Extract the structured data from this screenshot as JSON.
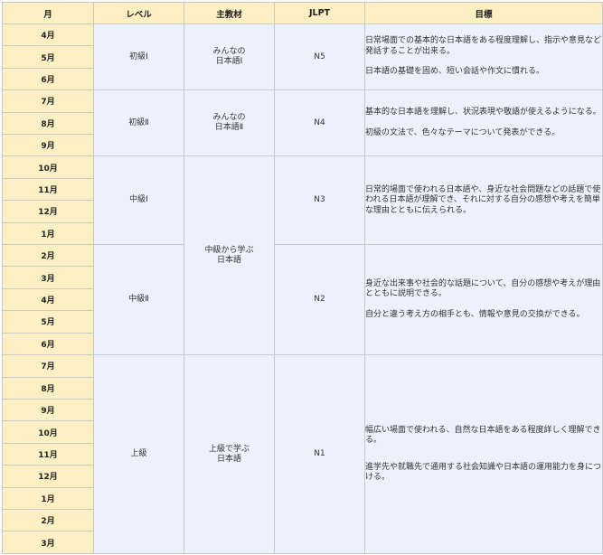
{
  "headers": {
    "month": "月",
    "level": "レベル",
    "textbook": "主教材",
    "jlpt": "JLPT",
    "goal": "目標"
  },
  "months": [
    "4月",
    "5月",
    "6月",
    "7月",
    "8月",
    "9月",
    "10月",
    "11月",
    "12月",
    "1月",
    "2月",
    "3月",
    "4月",
    "5月",
    "6月",
    "7月",
    "8月",
    "9月",
    "10月",
    "11月",
    "12月",
    "1月",
    "2月",
    "3月"
  ],
  "levels": [
    "初級Ⅰ",
    "初級Ⅱ",
    "中級Ⅰ",
    "中級Ⅱ",
    "上級"
  ],
  "textbooks": [
    "みんなの\n日本語Ⅰ",
    "みんなの\n日本語Ⅱ",
    "中級から学ぶ\n日本語",
    "上級で学ぶ\n日本語"
  ],
  "jlpt": [
    "N5",
    "N4",
    "N3",
    "N2",
    "N1"
  ],
  "goals": [
    [
      "日常場面での基本的な日本語をある程度理解し、指示や意見など発話することが出来る。",
      "日本語の基礎を固め、短い会話や作文に慣れる。"
    ],
    [
      "基本的な日本語を理解し、状況表現や敬語が使えるようになる。",
      "初級の文法で、色々なテーマについて発表ができる。"
    ],
    [
      "日常的場面で使われる日本語や、身近な社会問題などの話題で使われる日本語が理解でき、それに対する自分の感想や考えを簡単な理由とともに伝えられる。"
    ],
    [
      "身近な出来事や社会的な話題について、自分の感想や考えが理由とともに説明できる。",
      "自分と違う考え方の相手とも、情報や意見の交換ができる。"
    ],
    [
      "幅広い場面で使われる、自然な日本語をある程度詳しく理解できる。",
      "進学先や就職先で通用する社会知識や日本語の運用能力を身につける。"
    ]
  ]
}
